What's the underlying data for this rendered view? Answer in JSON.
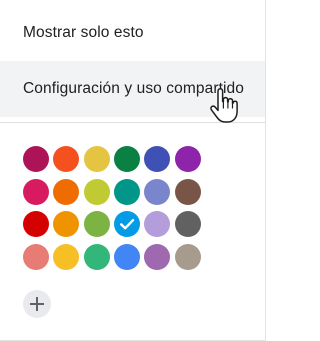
{
  "menu": {
    "items": [
      {
        "label": "Mostrar solo esto"
      },
      {
        "label": "Configuración y uso compartido"
      }
    ]
  },
  "palette": {
    "colors": [
      [
        "#ad1457",
        "#f4511e",
        "#e4c441",
        "#0b8043",
        "#3f51b5",
        "#8e24aa"
      ],
      [
        "#d81b60",
        "#ef6c00",
        "#c0ca33",
        "#009688",
        "#7986cb",
        "#795548"
      ],
      [
        "#d50000",
        "#f09300",
        "#7cb342",
        "#039be5",
        "#b39ddb",
        "#616161"
      ],
      [
        "#e67c73",
        "#f6bf26",
        "#33b679",
        "#4285f4",
        "#9e69af",
        "#a79b8e"
      ]
    ],
    "selected": {
      "row": 2,
      "col": 3
    },
    "icons": {
      "selected": "check-icon",
      "add": "plus-icon"
    }
  }
}
